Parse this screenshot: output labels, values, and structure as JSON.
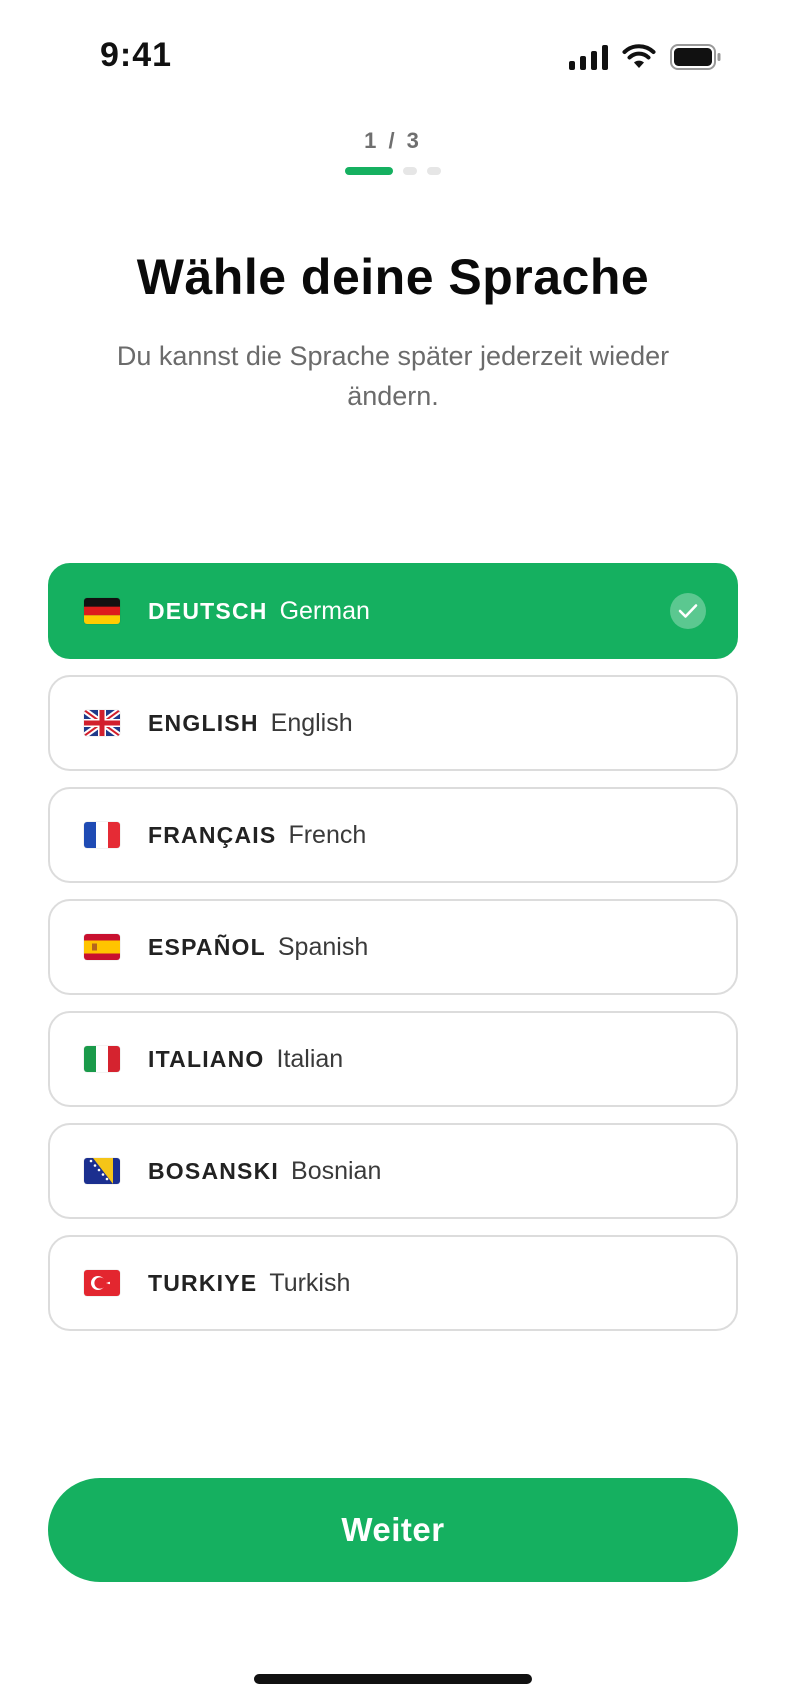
{
  "status_bar": {
    "time": "9:41",
    "icons": [
      "signal-icon",
      "wifi-icon",
      "battery-icon"
    ]
  },
  "onboarding": {
    "step_label": "1 / 3",
    "current_step": 1,
    "total_steps": 3,
    "title": "Wähle deine Sprache",
    "subtitle": "Du kannst die Sprache später jederzeit wieder ändern."
  },
  "languages": [
    {
      "native": "DEUTSCH",
      "english": "German",
      "flag": "germany-flag-icon",
      "selected": true
    },
    {
      "native": "ENGLISH",
      "english": "English",
      "flag": "uk-flag-icon",
      "selected": false
    },
    {
      "native": "FRANÇAIS",
      "english": "French",
      "flag": "france-flag-icon",
      "selected": false
    },
    {
      "native": "ESPAÑOL",
      "english": "Spanish",
      "flag": "spain-flag-icon",
      "selected": false
    },
    {
      "native": "ITALIANO",
      "english": "Italian",
      "flag": "italy-flag-icon",
      "selected": false
    },
    {
      "native": "BOSANSKI",
      "english": "Bosnian",
      "flag": "bosnia-flag-icon",
      "selected": false
    },
    {
      "native": "TURKIYE",
      "english": "Turkish",
      "flag": "turkey-flag-icon",
      "selected": false
    }
  ],
  "continue_button": {
    "label": "Weiter"
  },
  "colors": {
    "accent": "#15b060",
    "border": "#dcdcdc",
    "muted_text": "#6b6b6b",
    "step_text": "#6f6f6f"
  }
}
